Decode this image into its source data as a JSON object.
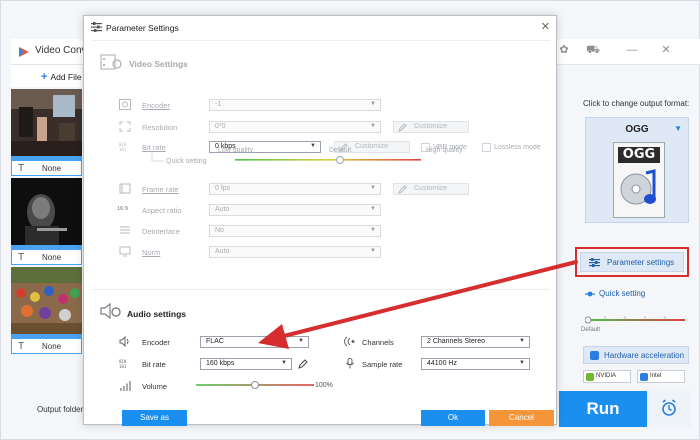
{
  "main_window": {
    "title": "Video Conv",
    "add_files_label": "Add File",
    "output_folder_label": "Output folder:",
    "subtitle_none": "None",
    "run_label": "Run"
  },
  "right_panel": {
    "format_hint": "Click to change output format:",
    "format_name": "OGG",
    "format_icon_text": "OGG",
    "parameter_settings_label": "Parameter settings",
    "quick_setting_label": "Quick setting",
    "quick_default_label": "Default",
    "hardware_acceleration_label": "Hardware acceleration",
    "gpu_nvidia": "NVIDIA",
    "gpu_intel": "Intel"
  },
  "dialog": {
    "title": "Parameter Settings",
    "video_section_title": "Video Settings",
    "video": {
      "encoder_label": "Encoder",
      "encoder_value": "-1",
      "resolution_label": "Resolution",
      "resolution_value": "0*0",
      "customize_label": "Customize",
      "bitrate_label": "Bit rate",
      "bitrate_value": "0 kbps",
      "vbr_label": "VBR mode",
      "lossless_label": "Lossless mode",
      "quick_setting_label": "Quick setting",
      "low_quality_label": "Low quality",
      "default_label": "Default",
      "high_quality_label": "High quality",
      "frame_rate_label": "Frame rate",
      "frame_rate_value": "0 fps",
      "aspect_ratio_label": "Aspect ratio",
      "aspect_ratio_value": "Auto",
      "deinterlace_label": "Deinterlace",
      "deinterlace_value": "No",
      "norm_label": "Norm",
      "norm_value": "Auto",
      "aspect_icon_text": "16:9"
    },
    "audio_section_title": "Audio settings",
    "audio": {
      "encoder_label": "Encoder",
      "encoder_value": "FLAC",
      "channels_label": "Channels",
      "channels_value": "2 Channels Stereo",
      "bitrate_label": "Bit rate",
      "bitrate_value": "160 kbps",
      "sample_rate_label": "Sample rate",
      "sample_rate_value": "44100 Hz",
      "volume_label": "Volume",
      "volume_value": "100%",
      "volume_level": 0.5
    },
    "save_as_label": "Save as",
    "ok_label": "Ok",
    "cancel_label": "Cancel"
  },
  "colors": {
    "accent_blue": "#1a8ff0",
    "cancel_orange": "#f39538",
    "annotation_red": "#d62e2e"
  }
}
